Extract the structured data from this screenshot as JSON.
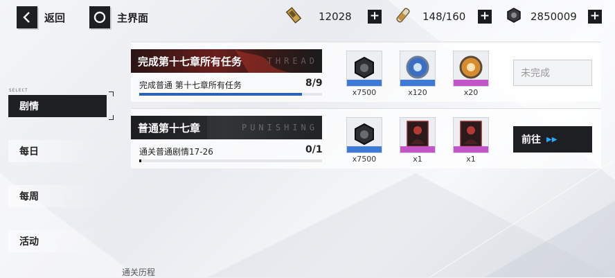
{
  "topbar": {
    "back_label": "返回",
    "home_label": "主界面",
    "resources": [
      {
        "icon": "battery-icon",
        "value": "12028"
      },
      {
        "icon": "serum-icon",
        "value": "148/160"
      },
      {
        "icon": "cog-coin-icon",
        "value": "2850009"
      }
    ]
  },
  "nav": {
    "select_tag": "SELECT",
    "items": [
      {
        "label": "剧情",
        "active": true
      },
      {
        "label": "每日",
        "active": false
      },
      {
        "label": "每周",
        "active": false
      },
      {
        "label": "活动",
        "active": false
      }
    ]
  },
  "tasks": [
    {
      "title": "完成第十七章所有任务",
      "watermark": "THREAD",
      "subtitle": "完成普通 第十七章所有任务",
      "progress_text": "8/9",
      "progress": 0.889,
      "rewards": [
        {
          "icon": "cog-coin-icon",
          "qty": "x7500",
          "rarity_color": "#3d7bd6"
        },
        {
          "icon": "blue-chip-icon",
          "qty": "x120",
          "rarity_color": "#3d7bd6"
        },
        {
          "icon": "orange-chip-icon",
          "qty": "x20",
          "rarity_color": "#c455c9"
        }
      ],
      "button": {
        "label": "未完成",
        "state": "disabled"
      }
    },
    {
      "title": "普通第十七章",
      "watermark": "PUNISHING",
      "subtitle": "通关普通剧情17-26",
      "progress_text": "0/1",
      "progress": 0.0,
      "rewards": [
        {
          "icon": "cog-coin-icon",
          "qty": "x7500",
          "rarity_color": "#3d7bd6"
        },
        {
          "icon": "character-card-icon",
          "qty": "x1",
          "rarity_color": "#c455c9"
        },
        {
          "icon": "character-card-icon",
          "qty": "x1",
          "rarity_color": "#c455c9"
        }
      ],
      "button": {
        "label": "前往",
        "state": "active"
      }
    }
  ],
  "footer": {
    "label": "通关历程"
  },
  "colors": {
    "accent_blue": "#2a62b8",
    "arrow_blue": "#2aa9ff",
    "dark": "#1e1f22"
  }
}
